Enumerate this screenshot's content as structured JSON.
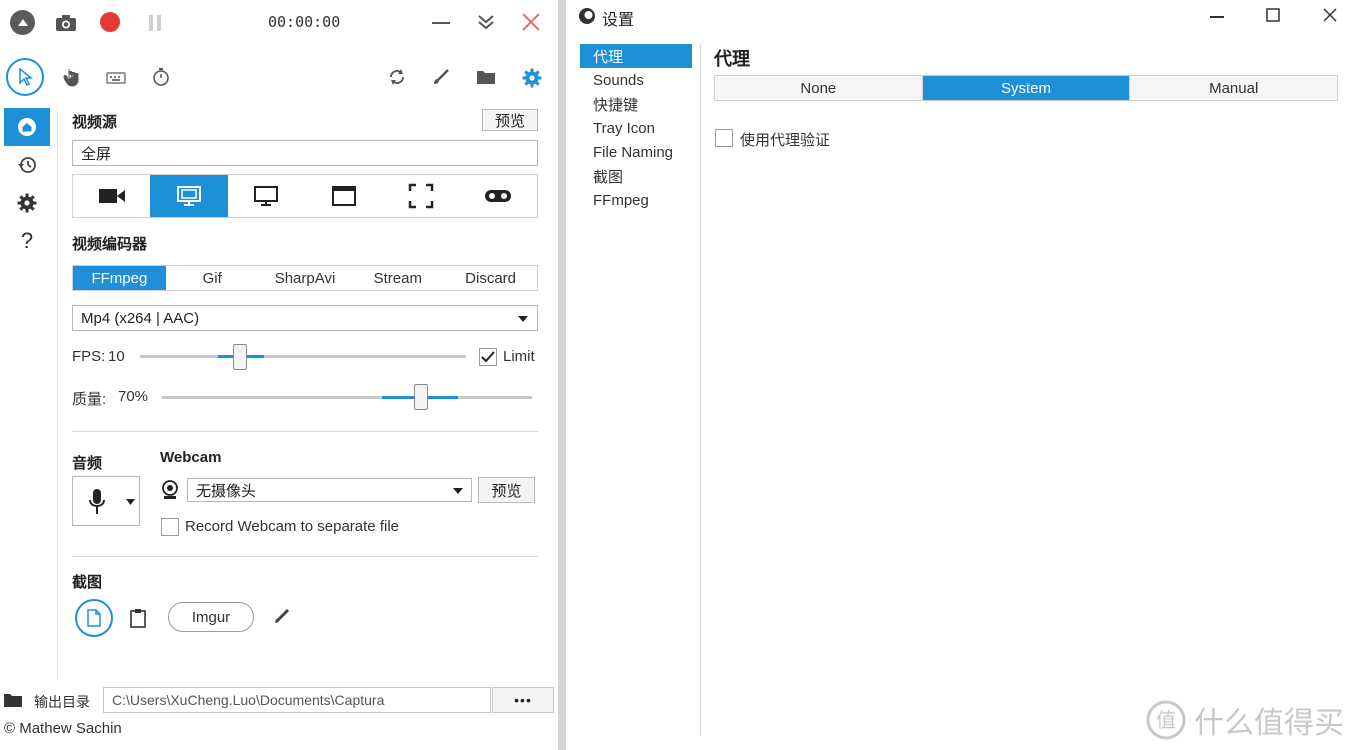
{
  "left": {
    "timer": "00:00:00",
    "video_source_label": "视频源",
    "preview_label": "预览",
    "source_value": "全屏",
    "encoder_label": "视频编码器",
    "encoder_tabs": [
      "FFmpeg",
      "Gif",
      "SharpAvi",
      "Stream",
      "Discard"
    ],
    "format_value": "Mp4 (x264 | AAC)",
    "fps_label": "FPS:",
    "fps_value": "10",
    "limit_label": "Limit",
    "quality_label": "质量:",
    "quality_value": "70%",
    "audio_label": "音频",
    "webcam_label": "Webcam",
    "webcam_value": "无摄像头",
    "webcam_preview": "预览",
    "webcam_separate": "Record Webcam to separate file",
    "screenshot_label": "截图",
    "imgur_label": "Imgur",
    "output_label": "输出目录",
    "output_path": "C:\\Users\\XuCheng.Luo\\Documents\\Captura",
    "more_label": "•••",
    "copyright": "© Mathew Sachin"
  },
  "right": {
    "title": "设置",
    "menu": [
      "代理",
      "Sounds",
      "快捷键",
      "Tray Icon",
      "File Naming",
      "截图",
      "FFmpeg"
    ],
    "heading": "代理",
    "proxy_tabs": [
      "None",
      "System",
      "Manual"
    ],
    "auth_label": "使用代理验证"
  },
  "watermark": "值 什么值得买",
  "colors": {
    "accent": "#1e90d8",
    "record": "#e53935",
    "close": "#e57373"
  },
  "state": {
    "fps_slider_fraction": 0.3,
    "quality_slider_fraction": 0.7,
    "limit_checked": true,
    "active_source": "screen",
    "active_encoder": "FFmpeg",
    "active_proxy": "System"
  }
}
